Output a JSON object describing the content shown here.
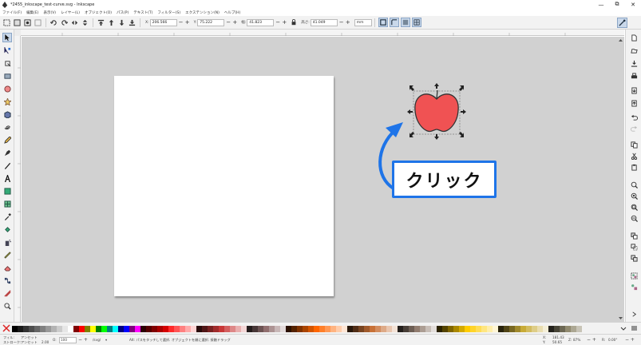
{
  "window": {
    "title": "*2455_inkscape_test-curve.svg - Inkscape",
    "minimize": "—",
    "maximize": "⧉",
    "close": "✕"
  },
  "menu": [
    "ファイル(F)",
    "編集(E)",
    "表示(V)",
    "レイヤー(L)",
    "オブジェクト(O)",
    "パス(P)",
    "テキスト(T)",
    "フィルター(S)",
    "エクステンション(N)",
    "ヘルプ(H)"
  ],
  "toolbar": {
    "x_label": "X:",
    "x_value": "206.566",
    "y_label": "Y:",
    "y_value": "75.222",
    "w_label": "幅:",
    "w_value": "41.823",
    "h_label": "高さ:",
    "h_value": "41.049",
    "unit": "mm"
  },
  "callout": {
    "text": "クリック",
    "border_color": "#1e74e8"
  },
  "apple": {
    "fill": "#f05253",
    "stroke": "#333333"
  },
  "status": {
    "fill_label": "フィル:",
    "stroke_label": "ストローク:",
    "fill_value": "アンセット",
    "stroke_value": "アンセット",
    "stroke_width": "2.00",
    "opacity_label": "O:",
    "opacity_value": "100",
    "layer": "/svg/",
    "message": "Alt: パスをタッチして選択. オブジェクトを順に選択. 接触ドラッグ",
    "coord_x_label": "X:",
    "coord_x": "181.43",
    "coord_y_label": "Y:",
    "coord_y": "50.65",
    "zoom_label": "Z:",
    "zoom": "87%",
    "rotate_label": "R:",
    "rotate": "0.00°"
  },
  "palette_colors": [
    "#000000",
    "#1a1a1a",
    "#333333",
    "#4d4d4d",
    "#666666",
    "#808080",
    "#999999",
    "#b3b3b3",
    "#cccccc",
    "#e6e6e6",
    "#ffffff",
    "#800000",
    "#ff0000",
    "#808000",
    "#ffff00",
    "#008000",
    "#00ff00",
    "#008080",
    "#00ffff",
    "#000080",
    "#0000ff",
    "#800080",
    "#ff00ff",
    "#2b0000",
    "#550000",
    "#800000",
    "#aa0000",
    "#d40000",
    "#ff2a2a",
    "#ff5555",
    "#ff8080",
    "#ffaaaa",
    "#ffd5d5",
    "#280b0b",
    "#501616",
    "#782121",
    "#a02c2c",
    "#c83737",
    "#d35f5f",
    "#de8787",
    "#e9afaf",
    "#f4d7d7",
    "#241c1c",
    "#483737",
    "#6c5353",
    "#916f6f",
    "#ac9393",
    "#c8b7b7",
    "#e3dbdb",
    "#2b1100",
    "#552200",
    "#803300",
    "#aa4400",
    "#d45500",
    "#ff6600",
    "#ff7f2a",
    "#ff9955",
    "#ffb380",
    "#ffccaa",
    "#ffe6d5",
    "#28170b",
    "#502d16",
    "#784421",
    "#a05a2c",
    "#c87137",
    "#d38d5f",
    "#deaa87",
    "#e9c6af",
    "#f4e3d7",
    "#241f1c",
    "#483e37",
    "#6c5d53",
    "#917c6f",
    "#ac9d93",
    "#c8beb7",
    "#e3dedb",
    "#2b2200",
    "#554400",
    "#806600",
    "#aa8800",
    "#d4aa00",
    "#ffcc00",
    "#ffd42a",
    "#ffdd55",
    "#ffe680",
    "#ffeeaa",
    "#fff6d5",
    "#28220b",
    "#504416",
    "#786721",
    "#a0892c",
    "#c8ab37",
    "#d3bc5f",
    "#decd87",
    "#e9ddaf",
    "#f4eed7",
    "#24221c",
    "#484537",
    "#6c6753",
    "#918a6f",
    "#aca793",
    "#c8c4b7"
  ]
}
